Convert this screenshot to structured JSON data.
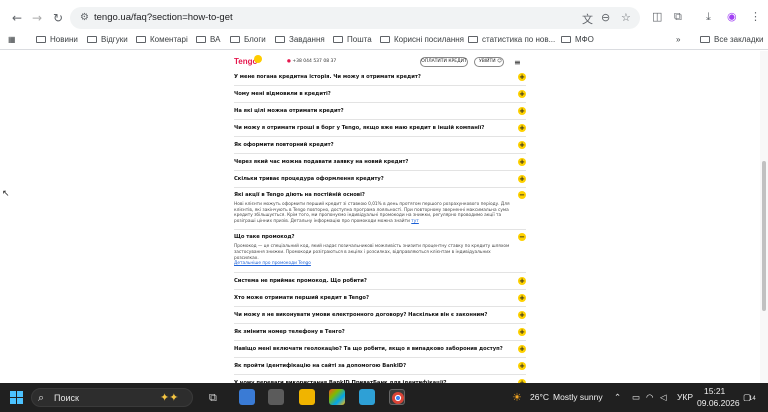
{
  "browser": {
    "url": "tengo.ua/faq?section=how-to-get",
    "bookmarks": [
      "Новини",
      "Відгуки",
      "Коментарі",
      "ВА",
      "Блоги",
      "Завдання",
      "Пошта",
      "Корисні посилання",
      "статистика по нов...",
      "МФО"
    ],
    "all_bookmarks": "Все закладки",
    "more": "»"
  },
  "site": {
    "logo": "Tengo",
    "phone": "+38 044 537 08 37",
    "apply_button": "ОПЛАТИТИ КРЕДИТ",
    "login_button": "УВІЙТИ"
  },
  "faq": [
    {
      "q": "У мене погана кредитна історія. Чи можу я отримати кредит?",
      "open": false
    },
    {
      "q": "Чому мені відмовили в кредиті?",
      "open": false
    },
    {
      "q": "На які цілі можна отримати кредит?",
      "open": false
    },
    {
      "q": "Чи можу я отримати гроші в борг у Tengo, якщо вже маю кредит в іншій компанії?",
      "open": false
    },
    {
      "q": "Як оформити повторний кредит?",
      "open": false
    },
    {
      "q": "Через який час можна подавати заявку на новий кредит?",
      "open": false
    },
    {
      "q": "Скільки триває процедура оформлення кредиту?",
      "open": false
    },
    {
      "q": "Які акції в Tengo діють на постійній основі?",
      "open": true,
      "a": "Нові клієнти можуть оформити перший кредит зі ставкою 0,01% в день протягом першого розрахункового періоду. Для клієнтів, які закінчують в Tengo повторно, доступна програма лояльності. При повторному зверненні максимальна сума кредиту збільшується. Крім того, ми пропонуємо індивідуальні промокоди на знижки, регулярно проводимо акції та розіграші цінних призів. Детальну інформацію про промокоди можна знайти",
      "link": "тут"
    },
    {
      "q": "Що таке промокод?",
      "open": true,
      "a": "Промокод — це спеціальний код, який надає позичальникові можливість знизити процентну ставку по кредиту шляхом застосування знижки. Промокоди розіграються в акціях і розсилках, відправляються клієнтам в індивідуальних розсилках.",
      "link": "Детальніше про промокоди Tengo"
    },
    {
      "q": "Система не приймає промокод. Що робити?",
      "open": false
    },
    {
      "q": "Хто може отримати перший кредит в Tengo?",
      "open": false
    },
    {
      "q": "Чи можу я не виконувати умови електронного договору? Наскільки він є законним?",
      "open": false
    },
    {
      "q": "Як змінити номер телефону в Тенго?",
      "open": false
    },
    {
      "q": "Навіщо мені включати геолокацію? Та що робити, якщо я випадково заборонив доступ?",
      "open": false
    },
    {
      "q": "Як пройти ідентифікацію на сайті за допомогою BankID?",
      "open": false
    },
    {
      "q": "У чому переваги використання BankID ПриватБанк для ідентифікації?",
      "open": false
    }
  ],
  "taskbar": {
    "search_placeholder": "Поиск",
    "weather_temp": "26°C",
    "weather_text": "Mostly sunny",
    "lang": "УКР",
    "time": "15:21",
    "date": "09.06.2026",
    "notifications": "14"
  },
  "colors": {
    "accent": "#ffd200",
    "brand": "#e5174d",
    "taskbar": "#202020"
  }
}
